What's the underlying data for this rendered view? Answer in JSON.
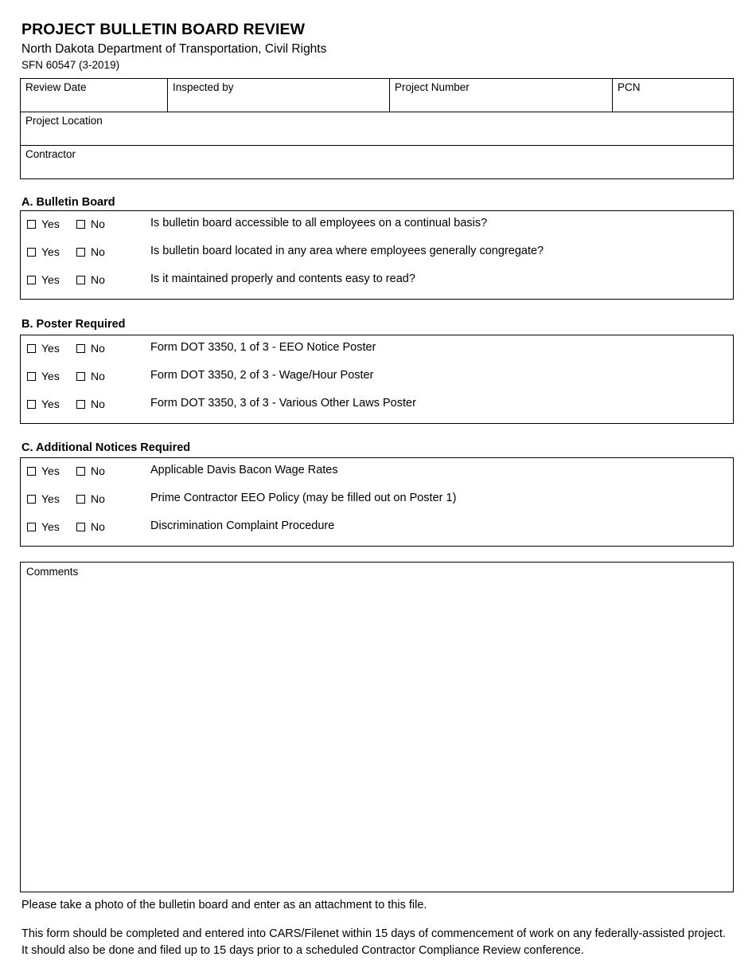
{
  "header": {
    "title": "PROJECT BULLETIN BOARD REVIEW",
    "subtitle": "North Dakota Department of Transportation, Civil Rights",
    "form_number": "SFN 60547 (3-2019)"
  },
  "info_table": {
    "review_date_label": "Review Date",
    "review_date_value": "",
    "inspected_by_label": "Inspected by",
    "inspected_by_value": "",
    "project_number_label": "Project Number",
    "project_number_value": "",
    "pcn_label": "PCN",
    "pcn_value": "",
    "project_location_label": "Project Location",
    "project_location_value": "",
    "contractor_label": "Contractor",
    "contractor_value": ""
  },
  "checkbox_labels": {
    "yes": "Yes",
    "no": "No"
  },
  "sections": [
    {
      "heading": "A. Bulletin Board",
      "rows": [
        {
          "yes": "Yes",
          "no": "No",
          "question": "Is bulletin board accessible to all employees on a continual basis?",
          "yes_checked": false,
          "no_checked": false
        },
        {
          "yes": "Yes",
          "no": "No",
          "question": "Is bulletin board located in any area where employees generally congregate?",
          "yes_checked": false,
          "no_checked": false
        },
        {
          "yes": "Yes",
          "no": "No",
          "question": "Is it maintained properly and contents easy to read?",
          "yes_checked": false,
          "no_checked": false
        }
      ]
    },
    {
      "heading": "B. Poster Required",
      "rows": [
        {
          "yes": "Yes",
          "no": "No",
          "question": "Form DOT 3350, 1 of 3 - EEO Notice Poster",
          "yes_checked": false,
          "no_checked": false
        },
        {
          "yes": "Yes",
          "no": "No",
          "question": "Form DOT 3350, 2 of 3 - Wage/Hour Poster",
          "yes_checked": false,
          "no_checked": false
        },
        {
          "yes": "Yes",
          "no": "No",
          "question": "Form DOT 3350, 3 of 3 - Various Other Laws Poster",
          "yes_checked": false,
          "no_checked": false
        }
      ]
    },
    {
      "heading": "C. Additional Notices Required",
      "rows": [
        {
          "yes": "Yes",
          "no": "No",
          "question": "Applicable Davis Bacon Wage Rates",
          "yes_checked": false,
          "no_checked": false
        },
        {
          "yes": "Yes",
          "no": "No",
          "question": "Prime Contractor EEO Policy (may be filled out on Poster 1)",
          "yes_checked": false,
          "no_checked": false
        },
        {
          "yes": "Yes",
          "no": "No",
          "question": "Discrimination Complaint Procedure",
          "yes_checked": false,
          "no_checked": false
        }
      ]
    }
  ],
  "comments": {
    "label": "Comments",
    "value": ""
  },
  "footer": {
    "line1": "Please take a photo of the bulletin board and enter as an attachment to this file.",
    "line2": "This form should be completed and entered into CARS/Filenet within 15 days of commencement of work on any federally-assisted project.  It should also be done and filed up to 15 days prior to a scheduled Contractor Compliance Review conference."
  }
}
